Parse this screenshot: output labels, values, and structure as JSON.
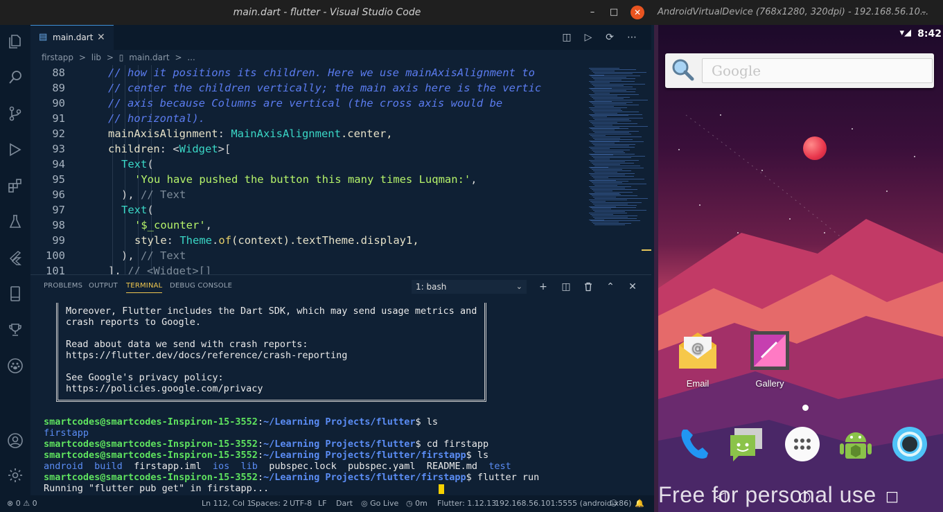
{
  "vscode": {
    "window_title": "main.dart - flutter - Visual Studio Code",
    "window_controls": {
      "minimize": "–",
      "maximize": "□",
      "close": "✕"
    },
    "activity_icons": [
      "files-icon",
      "search-icon",
      "source-control-icon",
      "debug-icon",
      "extensions-icon",
      "flask-icon",
      "flutter-icon",
      "device-icon",
      "trophy-icon",
      "paw-icon",
      "account-icon",
      "settings-gear-icon"
    ],
    "tab": {
      "label": "main.dart",
      "close": "✕"
    },
    "tab_actions": {
      "split": "◫",
      "run": "▷",
      "debug_run": "⟳",
      "more": "⋯"
    },
    "breadcrumb": [
      "firstapp",
      ">",
      "lib",
      ">",
      "main.dart",
      ">",
      "..."
    ],
    "editor_lines": [
      {
        "n": "88",
        "indent": 6,
        "parts": [
          {
            "t": "// how it positions its children. Here we use mainAxisAlignment to",
            "c": "cm"
          }
        ]
      },
      {
        "n": "89",
        "indent": 6,
        "parts": [
          {
            "t": "// center the children vertically; the main axis here is the vertic",
            "c": "cm"
          }
        ]
      },
      {
        "n": "90",
        "indent": 6,
        "parts": [
          {
            "t": "// axis because Columns are vertical (the cross axis would be",
            "c": "cm"
          }
        ]
      },
      {
        "n": "91",
        "indent": 6,
        "parts": [
          {
            "t": "// horizontal).",
            "c": "cm"
          }
        ]
      },
      {
        "n": "92",
        "indent": 6,
        "parts": [
          {
            "t": "mainAxisAlignment",
            "c": "kw"
          },
          {
            "t": ": ",
            "c": "punc"
          },
          {
            "t": "MainAxisAlignment",
            "c": "cls"
          },
          {
            "t": ".center,",
            "c": "kw"
          }
        ]
      },
      {
        "n": "93",
        "indent": 6,
        "parts": [
          {
            "t": "children",
            "c": "kw"
          },
          {
            "t": ": <",
            "c": "punc"
          },
          {
            "t": "Widget",
            "c": "cls"
          },
          {
            "t": ">[",
            "c": "punc"
          }
        ]
      },
      {
        "n": "94",
        "indent": 7,
        "parts": [
          {
            "t": "Text",
            "c": "cls"
          },
          {
            "t": "(",
            "c": "punc"
          }
        ]
      },
      {
        "n": "95",
        "indent": 8,
        "parts": [
          {
            "t": "'You have pushed the button this many times Luqman:'",
            "c": "str"
          },
          {
            "t": ",",
            "c": "punc"
          }
        ]
      },
      {
        "n": "96",
        "indent": 7,
        "parts": [
          {
            "t": "), ",
            "c": "punc"
          },
          {
            "t": "// Text",
            "c": "hint"
          }
        ]
      },
      {
        "n": "97",
        "indent": 7,
        "parts": [
          {
            "t": "Text",
            "c": "cls"
          },
          {
            "t": "(",
            "c": "punc"
          }
        ]
      },
      {
        "n": "98",
        "indent": 8,
        "parts": [
          {
            "t": "'$_counter'",
            "c": "str"
          },
          {
            "t": ",",
            "c": "punc"
          }
        ]
      },
      {
        "n": "99",
        "indent": 8,
        "parts": [
          {
            "t": "style",
            "c": "kw"
          },
          {
            "t": ": ",
            "c": "punc"
          },
          {
            "t": "Theme",
            "c": "cls"
          },
          {
            "t": ".",
            "c": "punc"
          },
          {
            "t": "of",
            "c": "fn"
          },
          {
            "t": "(context).textTheme.display1,",
            "c": "kw"
          }
        ]
      },
      {
        "n": "100",
        "indent": 7,
        "parts": [
          {
            "t": "), ",
            "c": "punc"
          },
          {
            "t": "// Text",
            "c": "hint"
          }
        ]
      },
      {
        "n": "101",
        "indent": 6,
        "parts": [
          {
            "t": "], ",
            "c": "punc"
          },
          {
            "t": "// <Widget>[]",
            "c": "hint"
          }
        ]
      }
    ],
    "panel": {
      "tabs": [
        "PROBLEMS",
        "OUTPUT",
        "TERMINAL",
        "DEBUG CONSOLE"
      ],
      "terminal_select": "1: bash",
      "actions": {
        "add": "+",
        "split": "◫",
        "trash": "🗑",
        "maximize": "⌃",
        "close": "✕"
      }
    },
    "terminal": {
      "box_lines": [
        "Moreover, Flutter includes the Dart SDK, which may send usage metrics and",
        "crash reports to Google.",
        "",
        "Read about data we send with crash reports:",
        "https://flutter.dev/docs/reference/crash-reporting",
        "",
        "See Google's privacy policy:",
        "https://policies.google.com/privacy"
      ],
      "prompt_user": "smartcodes@smartcodes-Inspiron-15-3552",
      "path1": "~/Learning Projects/flutter",
      "path2": "~/Learning Projects/flutter/firstapp",
      "cmd1": "$ ls",
      "out1": "firstapp",
      "cmd2": "$ cd firstapp",
      "cmd3": "$ ls",
      "ls_dirs": [
        "android",
        "build",
        "ios",
        "lib",
        "test"
      ],
      "ls_files": [
        "firstapp.iml",
        "pubspec.lock",
        "pubspec.yaml",
        "README.md"
      ],
      "cmd4": "$ flutter run",
      "running": "Running \"flutter pub get\" in firstapp..."
    },
    "statusbar": {
      "errors": "⊗ 0 ⚠ 0",
      "position": "Ln 112, Col 1",
      "spaces": "Spaces: 2",
      "encoding": "UTF-8",
      "eol": "LF",
      "language": "Dart",
      "golive": "◎ Go Live",
      "time": "◷ 0m",
      "flutter": "Flutter: 1.12.13",
      "device": "192.168.56.101:5555 (android-x86)"
    }
  },
  "emulator": {
    "window_title": "AndroidVirtualDevice (768x1280, 320dpi) - 192.168.56.10...",
    "minimize": "–",
    "status_time": "8:42",
    "status_icons": "▾◢",
    "search_placeholder": "Google",
    "apps": [
      {
        "label": "Email"
      },
      {
        "label": "Gallery"
      }
    ],
    "watermark": "Free for personal use",
    "nav": {
      "back": "◁",
      "home": "○",
      "recents": "□"
    }
  }
}
